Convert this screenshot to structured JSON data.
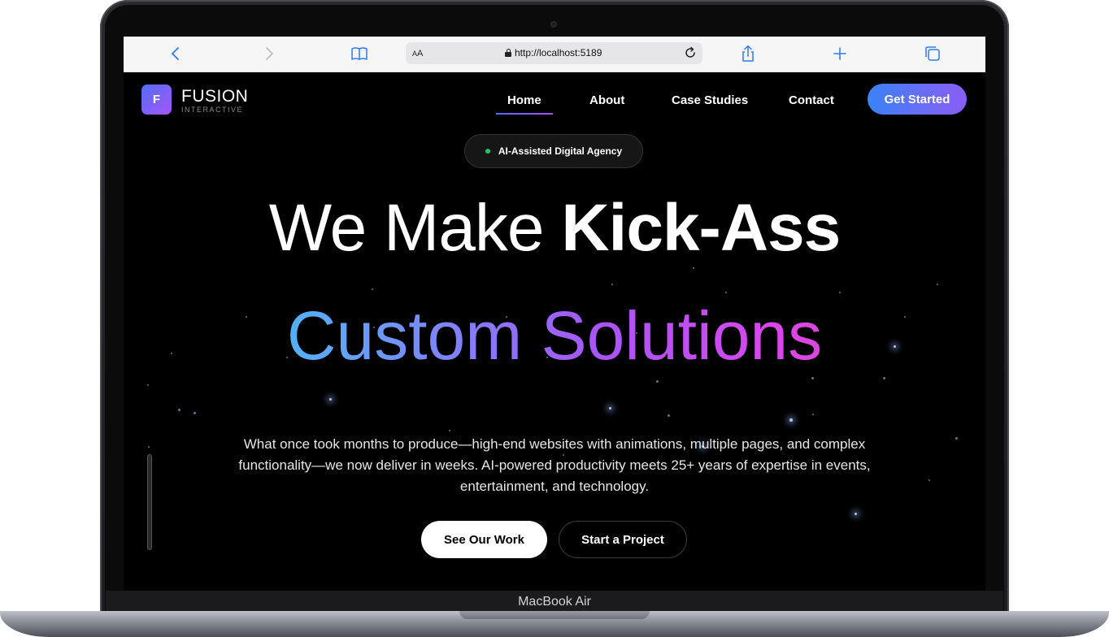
{
  "browser": {
    "address_small": "A",
    "address_large": "A",
    "url": "http://localhost:5189"
  },
  "site": {
    "logo_letter": "F",
    "logo_name": "FUSION",
    "logo_sub": "INTERACTIVE",
    "nav": [
      {
        "label": "Home"
      },
      {
        "label": "About"
      },
      {
        "label": "Case Studies"
      },
      {
        "label": "Contact"
      }
    ],
    "cta": "Get Started",
    "badge": "AI-Assisted Digital Agency",
    "headline_light": "We Make ",
    "headline_bold": "Kick-Ass",
    "headline_gradient": "Custom Solutions",
    "paragraph": "What once took months to produce—high-end websites with animations, multiple pages, and complex functionality—we now deliver in weeks. AI-powered productivity meets 25+ years of expertise in events, entertainment, and technology.",
    "primary_button": "See Our Work",
    "secondary_button": "Start a Project"
  },
  "device": {
    "label": "MacBook Air"
  },
  "colors": {
    "accent_start": "#3b82f6",
    "accent_end": "#8b5cf6",
    "status_dot": "#22c55e"
  },
  "icons": [
    "back-icon",
    "forward-icon",
    "bookmarks-icon",
    "lock-icon",
    "reload-icon",
    "share-icon",
    "new-tab-icon",
    "tabs-icon"
  ]
}
